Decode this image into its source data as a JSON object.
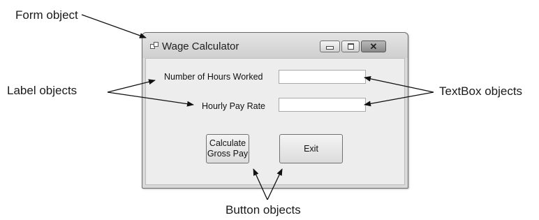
{
  "callouts": {
    "form": "Form object",
    "labels": "Label objects",
    "textboxes": "TextBox objects",
    "buttons": "Button objects"
  },
  "window": {
    "title": "Wage Calculator",
    "controls": {
      "minimize_icon": "minimize-icon",
      "maximize_icon": "maximize-icon",
      "close_icon": "close-icon"
    }
  },
  "form": {
    "hours_label": "Number of Hours Worked",
    "rate_label": "Hourly Pay Rate",
    "hours_value": "",
    "rate_value": "",
    "calculate_button": "Calculate\nGross Pay",
    "exit_button": "Exit"
  },
  "colors": {
    "window_frame": "#d9d9d9",
    "client_area": "#ededed",
    "text": "#1a1a1a"
  }
}
